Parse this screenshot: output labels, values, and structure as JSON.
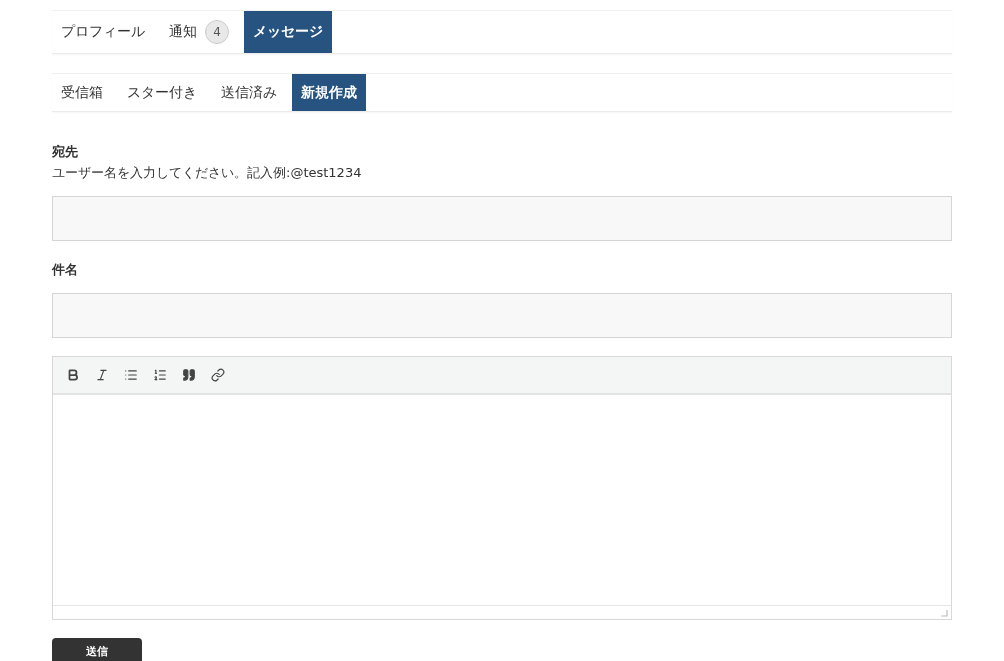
{
  "main_tabs": [
    {
      "label": "プロフィール",
      "selected": false
    },
    {
      "label": "通知",
      "badge": "4",
      "selected": false
    },
    {
      "label": "メッセージ",
      "selected": true
    }
  ],
  "sub_tabs": [
    {
      "label": "受信箱",
      "selected": false
    },
    {
      "label": "スター付き",
      "selected": false
    },
    {
      "label": "送信済み",
      "selected": false
    },
    {
      "label": "新規作成",
      "selected": true
    }
  ],
  "to_field": {
    "label": "宛先",
    "help": "ユーザー名を入力してください。記入例:@test1234"
  },
  "subject_field": {
    "label": "件名"
  },
  "editor": {
    "tools": [
      {
        "kind": "bold"
      },
      {
        "kind": "italic"
      },
      {
        "kind": "bullet-list"
      },
      {
        "kind": "numbered-list"
      },
      {
        "kind": "quote"
      },
      {
        "kind": "link"
      }
    ]
  },
  "submit_button": "送信"
}
